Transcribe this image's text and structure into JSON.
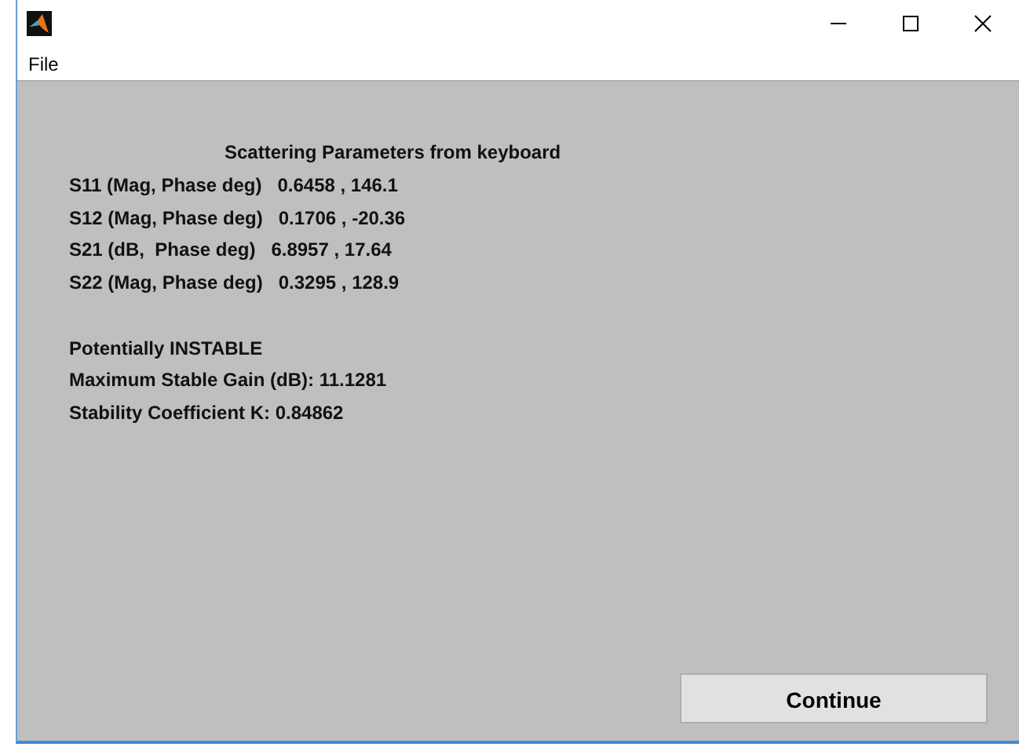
{
  "menu": [
    "File"
  ],
  "heading": "Scattering Parameters from keyboard",
  "parameters": [
    {
      "label": "S11 (Mag, Phase deg)",
      "value": "0.6458 , 146.1"
    },
    {
      "label": "S12 (Mag, Phase deg)",
      "value": "0.1706 , -20.36"
    },
    {
      "label": "S21 (dB,  Phase deg)",
      "value": "6.8957 , 17.64"
    },
    {
      "label": "S22 (Mag, Phase deg)",
      "value": "0.3295 , 128.9"
    }
  ],
  "results": [
    "Potentially INSTABLE",
    "Maximum Stable Gain (dB): 11.1281",
    "Stability Coefficient K: 0.84862"
  ],
  "buttons": [
    "Continue"
  ]
}
